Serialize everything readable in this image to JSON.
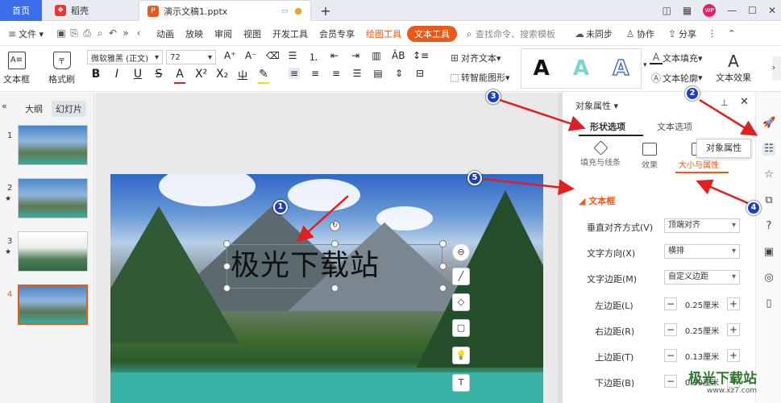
{
  "titlebar": {
    "tabs": [
      {
        "label": "首页"
      },
      {
        "label": "稻壳"
      },
      {
        "label": "演示文稿1.pptx"
      }
    ],
    "add": "+"
  },
  "menubar": {
    "file": "文件",
    "items": [
      "动画",
      "放映",
      "审阅",
      "视图",
      "开发工具",
      "会员专享",
      "绘图工具",
      "文本工具"
    ],
    "search_placeholder": "查找命令、搜索模板",
    "sync": "未同步",
    "collab": "协作",
    "share": "分享"
  },
  "ribbon": {
    "textbox": "文本框",
    "format_painter": "格式刷",
    "font_name": "微软雅黑 (正文)",
    "font_size": "72",
    "align_text": "对齐文本",
    "smart_shape": "转智能图形",
    "text_fill": "文本填充",
    "text_outline": "文本轮廓",
    "text_effect": "文本效果",
    "style_glyph": "A"
  },
  "left_pane": {
    "tab_outline": "大纲",
    "tab_slides": "幻灯片",
    "slide_numbers": [
      "1",
      "2",
      "3",
      "4"
    ]
  },
  "slide": {
    "text": "极光下载站"
  },
  "right_pane": {
    "title": "对象属性",
    "tab_shape": "形状选项",
    "tab_text": "文本选项",
    "sub_fill": "填充与线条",
    "sub_effect": "效果",
    "sub_size": "大小与属性",
    "section": "文本框",
    "rows": [
      {
        "label": "垂直对齐方式(V)",
        "value": "顶端对齐"
      },
      {
        "label": "文字方向(X)",
        "value": "横排"
      },
      {
        "label": "文字边距(M)",
        "value": "自定义边距"
      }
    ],
    "spins": [
      {
        "label": "左边距(L)",
        "value": "0.25厘米"
      },
      {
        "label": "右边距(R)",
        "value": "0.25厘米"
      },
      {
        "label": "上边距(T)",
        "value": "0.13厘米"
      },
      {
        "label": "下边距(B)",
        "value": "0.30厘米"
      }
    ]
  },
  "tooltip": "对象属性",
  "badges": [
    "1",
    "2",
    "3",
    "4",
    "5"
  ],
  "watermark": {
    "main": "极光下载站",
    "url": "www.xz7.com"
  },
  "colors": {
    "accent": "#e8591a",
    "blue": "#3b6ee8",
    "badge": "#1f3fb8",
    "arrow": "#e02020"
  }
}
